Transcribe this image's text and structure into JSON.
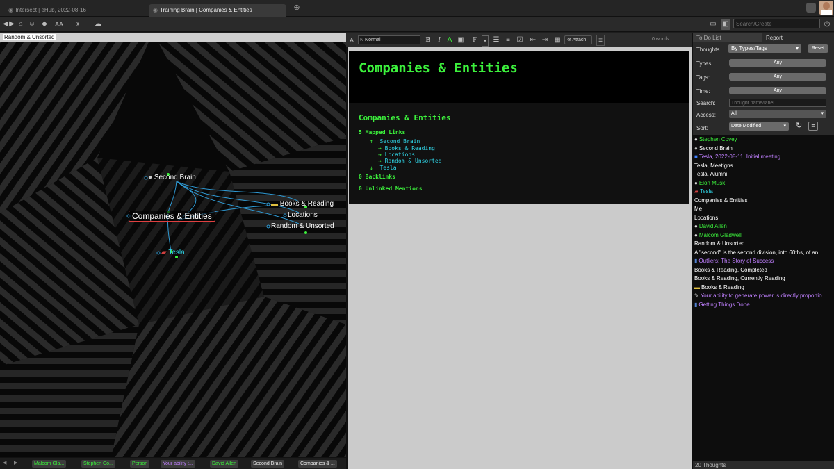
{
  "tabs": [
    {
      "label": "Intersect | eHub, 2022-08-16",
      "active": false
    },
    {
      "label": "Training Brain | Companies & Entities",
      "active": true
    }
  ],
  "toolbar": {
    "search_placeholder": "Search/Create",
    "font_size_icon": "AA"
  },
  "breadcrumb": "Random & Unsorted",
  "brain": {
    "nodes": {
      "second_brain": "Second Brain",
      "companies": "Companies & Entities",
      "books": "Books & Reading",
      "locations": "Locations",
      "random": "Random & Unsorted",
      "tesla": "Tesla"
    }
  },
  "editor": {
    "style_select": "Normal",
    "attach_label": "Attach",
    "word_count": "0 words",
    "title": "Companies & Entities",
    "section_title": "Companies & Entities",
    "mapped_links_label": "5 Mapped Links",
    "parent_link": "Second Brain",
    "jump_links": [
      "Books & Reading",
      "Locations",
      "Random & Unsorted"
    ],
    "child_link": "Tesla",
    "backlinks_label": "0 Backlinks",
    "unlinked_label": "0 Unlinked Mentions"
  },
  "panel": {
    "tabs": [
      "To Do List",
      "Report"
    ],
    "thoughts_label": "Thoughts",
    "thoughts_select": "By Types/Tags",
    "reset_label": "Reset",
    "types_label": "Types:",
    "types_value": "Any",
    "tags_label": "Tags:",
    "tags_value": "Any",
    "time_label": "Time:",
    "time_value": "Any",
    "search_label": "Search:",
    "search_placeholder": "Thought name/label",
    "access_label": "Access:",
    "access_value": "All",
    "sort_label": "Sort:",
    "sort_value": "Date Modified",
    "footer": "20 Thoughts"
  },
  "thought_list": [
    {
      "label": "Stephen Covey",
      "color": "green",
      "icon": "person-icon"
    },
    {
      "label": "Second Brain",
      "color": "white",
      "icon": "brain-icon"
    },
    {
      "label": "Tesla, 2022-08-11, Initial meeting",
      "color": "violet",
      "icon": "event-icon"
    },
    {
      "label": "Tesla, Meetigns",
      "color": "white",
      "icon": ""
    },
    {
      "label": "Tesla, Alumni",
      "color": "white",
      "icon": ""
    },
    {
      "label": "Elon Musk",
      "color": "green",
      "icon": "person-icon"
    },
    {
      "label": "Tesla",
      "color": "cyan",
      "icon": "car-icon"
    },
    {
      "label": "Companies & Entities",
      "color": "white",
      "icon": ""
    },
    {
      "label": "Me",
      "color": "white",
      "icon": ""
    },
    {
      "label": "Locations",
      "color": "white",
      "icon": ""
    },
    {
      "label": "David Allen",
      "color": "green",
      "icon": "person-icon"
    },
    {
      "label": "Malcom Gladwell",
      "color": "green",
      "icon": "person-icon"
    },
    {
      "label": "Random & Unsorted",
      "color": "white",
      "icon": ""
    },
    {
      "label": "A \"second\" is the second division, into 60ths, of an...",
      "color": "white",
      "icon": ""
    },
    {
      "label": "Outliers: The Story of Success",
      "color": "violet",
      "icon": "book-icon"
    },
    {
      "label": "Books & Reading, Completed",
      "color": "white",
      "icon": ""
    },
    {
      "label": "Books & Reading, Currently Reading",
      "color": "white",
      "icon": ""
    },
    {
      "label": "Books & Reading",
      "color": "white",
      "icon": "books-icon"
    },
    {
      "label": "Your ability to generate power is directly proportio...",
      "color": "violet",
      "icon": "quote-icon"
    },
    {
      "label": "Getting Things Done",
      "color": "violet",
      "icon": "book-icon"
    }
  ],
  "bottom_bar": [
    {
      "label": "Malcom Gla...",
      "color": "green"
    },
    {
      "label": "Stephen Co...",
      "color": "green"
    },
    {
      "label": "Person",
      "color": "green"
    },
    {
      "label": "Your ability t...",
      "color": "violet"
    },
    {
      "label": "David Allen",
      "color": "green"
    },
    {
      "label": "Second Brain",
      "color": "white"
    },
    {
      "label": "Companies & ...",
      "color": "white"
    }
  ]
}
